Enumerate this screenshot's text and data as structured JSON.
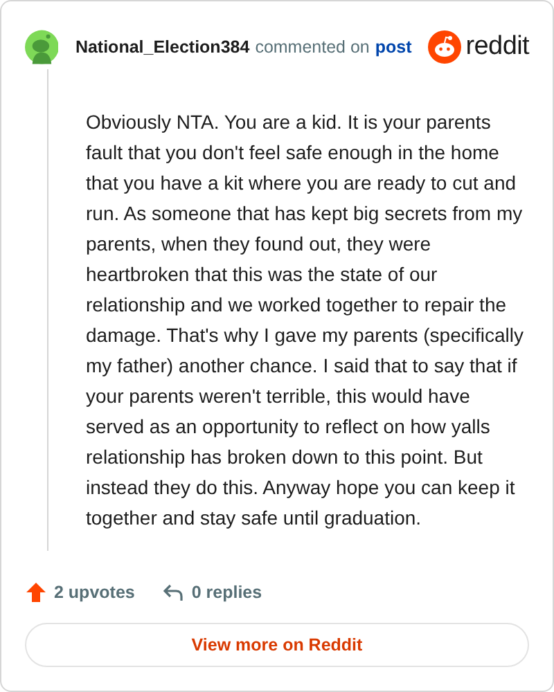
{
  "comment": {
    "author": "National_Election384",
    "action": "commented on",
    "target": "post",
    "brand": "reddit",
    "body": "Obviously NTA. You are a kid. It is your parents fault that you don't feel safe enough in the home that you have a kit where you are ready to cut and run. As someone that has kept big secrets from my parents, when they found out, they were heartbroken that this was the state of our relationship and we worked together to repair the damage. That's why I gave my parents (specifically my father) another chance. I said that to say that if your parents weren't terrible, this would have served as an opportunity to reflect on how yalls relationship has broken down to this point. But instead they do this. Anyway hope you can keep it together and stay safe until graduation.",
    "upvotes": "2 upvotes",
    "replies": "0 replies"
  },
  "button": {
    "label": "View more on Reddit"
  }
}
